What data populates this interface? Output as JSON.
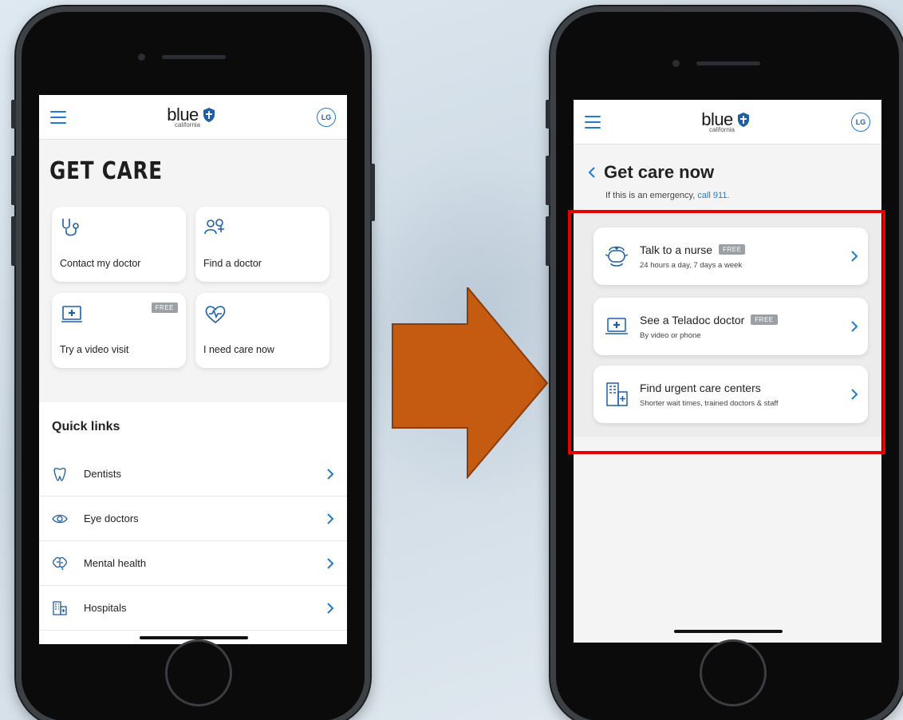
{
  "left_screen": {
    "header": {
      "logo_word": "blue",
      "logo_sub": "california",
      "avatar": "LG"
    },
    "page_title": "GET CARE",
    "tiles": [
      {
        "label": "Contact my doctor",
        "icon": "stethoscope-icon"
      },
      {
        "label": "Find a doctor",
        "icon": "doctor-search-icon"
      },
      {
        "label": "Try a video visit",
        "icon": "video-visit-icon",
        "badge": "FREE"
      },
      {
        "label": "I need care now",
        "icon": "heart-pulse-icon"
      }
    ],
    "quick_links": {
      "title": "Quick links",
      "items": [
        {
          "label": "Dentists",
          "icon": "tooth-icon"
        },
        {
          "label": "Eye doctors",
          "icon": "eye-icon"
        },
        {
          "label": "Mental health",
          "icon": "brain-icon"
        },
        {
          "label": "Hospitals",
          "icon": "hospital-icon"
        }
      ]
    }
  },
  "right_screen": {
    "header": {
      "logo_word": "blue",
      "logo_sub": "california",
      "avatar": "LG"
    },
    "title": "Get care now",
    "emergency_text": "If this is an emergency,",
    "emergency_link": "call 911.",
    "cards": [
      {
        "title": "Talk to a nurse",
        "badge": "FREE",
        "subtitle": "24 hours a day, 7 days a week",
        "icon": "nurse-icon"
      },
      {
        "title": "See a Teladoc doctor",
        "badge": "FREE",
        "subtitle": "By video or phone",
        "icon": "video-visit-icon"
      },
      {
        "title": "Find urgent care centers",
        "badge": "",
        "subtitle": "Shorter wait times, trained doctors & staff",
        "icon": "building-icon"
      }
    ]
  },
  "colors": {
    "accent": "#1f7ad0",
    "arrow": "#c55a11",
    "highlight": "#e60000",
    "badge": "#9aa0a6"
  }
}
